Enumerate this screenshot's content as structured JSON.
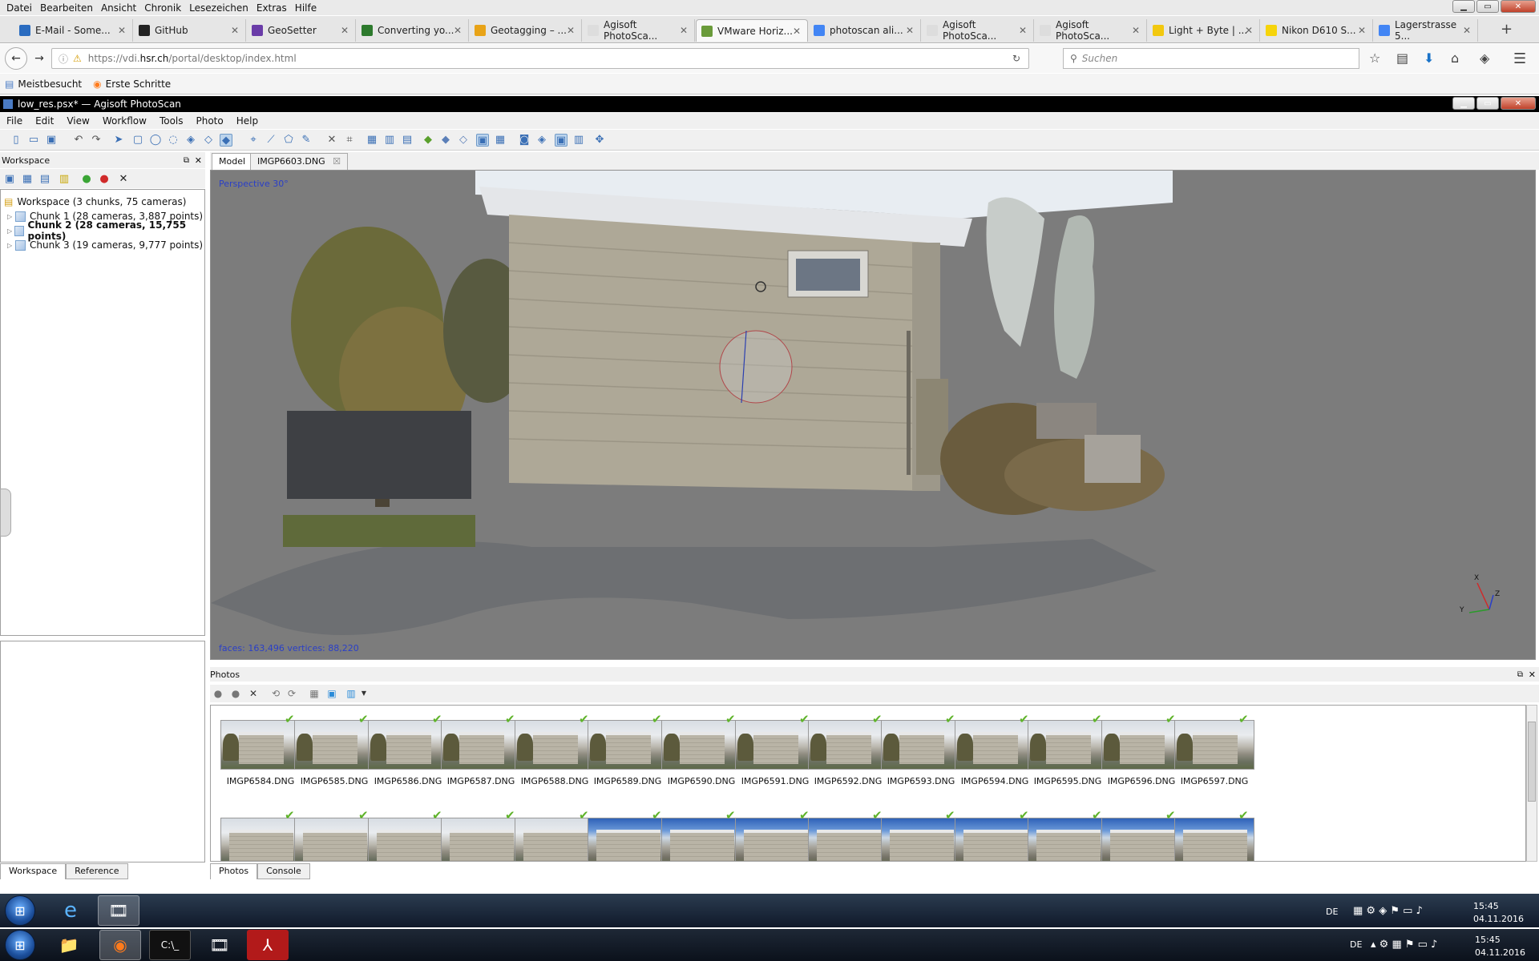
{
  "firefox": {
    "menu": [
      "Datei",
      "Bearbeiten",
      "Ansicht",
      "Chronik",
      "Lesezeichen",
      "Extras",
      "Hilfe"
    ],
    "tabs": [
      {
        "label": "E-Mail - Some...",
        "color": "#2a6cc0",
        "active": false
      },
      {
        "label": "GitHub",
        "color": "#222222",
        "active": false
      },
      {
        "label": "GeoSetter",
        "color": "#6a3ca8",
        "active": false
      },
      {
        "label": "Converting yo...",
        "color": "#2d7a2d",
        "active": false
      },
      {
        "label": "Geotagging – ...",
        "color": "#e8a317",
        "active": false
      },
      {
        "label": "Agisoft PhotoSca...",
        "color": "#dddddd",
        "active": false
      },
      {
        "label": "VMware Horiz...",
        "color": "#6a9b3a",
        "active": true
      },
      {
        "label": "photoscan ali...",
        "color": "#4285f4",
        "active": false
      },
      {
        "label": "Agisoft PhotoSca...",
        "color": "#dddddd",
        "active": false
      },
      {
        "label": "Agisoft PhotoSca...",
        "color": "#dddddd",
        "active": false
      },
      {
        "label": "Light + Byte | ...",
        "color": "#f2c80f",
        "active": false
      },
      {
        "label": "Nikon D610 S...",
        "color": "#f6d40a",
        "active": false
      },
      {
        "label": "Lagerstrasse 5...",
        "color": "#4285f4",
        "active": false
      }
    ],
    "url_prefix": "https://vdi.",
    "url_host": "hsr.ch",
    "url_path": "/portal/desktop/index.html",
    "search_placeholder": "Suchen",
    "bookmarks": [
      "Meistbesucht",
      "Erste Schritte"
    ]
  },
  "photoscan": {
    "title": "low_res.psx* — Agisoft PhotoScan",
    "menu": [
      "File",
      "Edit",
      "View",
      "Workflow",
      "Tools",
      "Photo",
      "Help"
    ],
    "workspace_label": "Workspace",
    "tree_root": "Workspace (3 chunks, 75 cameras)",
    "chunks": [
      {
        "label": "Chunk 1 (28 cameras, 3,887 points)",
        "bold": false
      },
      {
        "label": "Chunk 2 (28 cameras, 15,755 points)",
        "bold": true
      },
      {
        "label": "Chunk 3 (19 cameras, 9,777 points)",
        "bold": false
      }
    ],
    "left_tabs": [
      "Workspace",
      "Reference"
    ],
    "doc_tabs": [
      "Model",
      "IMGP6603.DNG"
    ],
    "view_label": "Perspective 30°",
    "view_stats": "faces: 163,496 vertices: 88,220",
    "axes": [
      "X",
      "Y",
      "Z"
    ],
    "photos_label": "Photos",
    "bottom_tabs": [
      "Photos",
      "Console"
    ],
    "photos_row1": [
      "IMGP6584.DNG",
      "IMGP6585.DNG",
      "IMGP6586.DNG",
      "IMGP6587.DNG",
      "IMGP6588.DNG",
      "IMGP6589.DNG",
      "IMGP6590.DNG",
      "IMGP6591.DNG",
      "IMGP6592.DNG",
      "IMGP6593.DNG",
      "IMGP6594.DNG",
      "IMGP6595.DNG",
      "IMGP6596.DNG",
      "IMGP6597.DNG"
    ],
    "photos_row2_count": 14
  },
  "taskbar": {
    "lang": "DE",
    "time": "15:45",
    "date": "04.11.2016"
  }
}
